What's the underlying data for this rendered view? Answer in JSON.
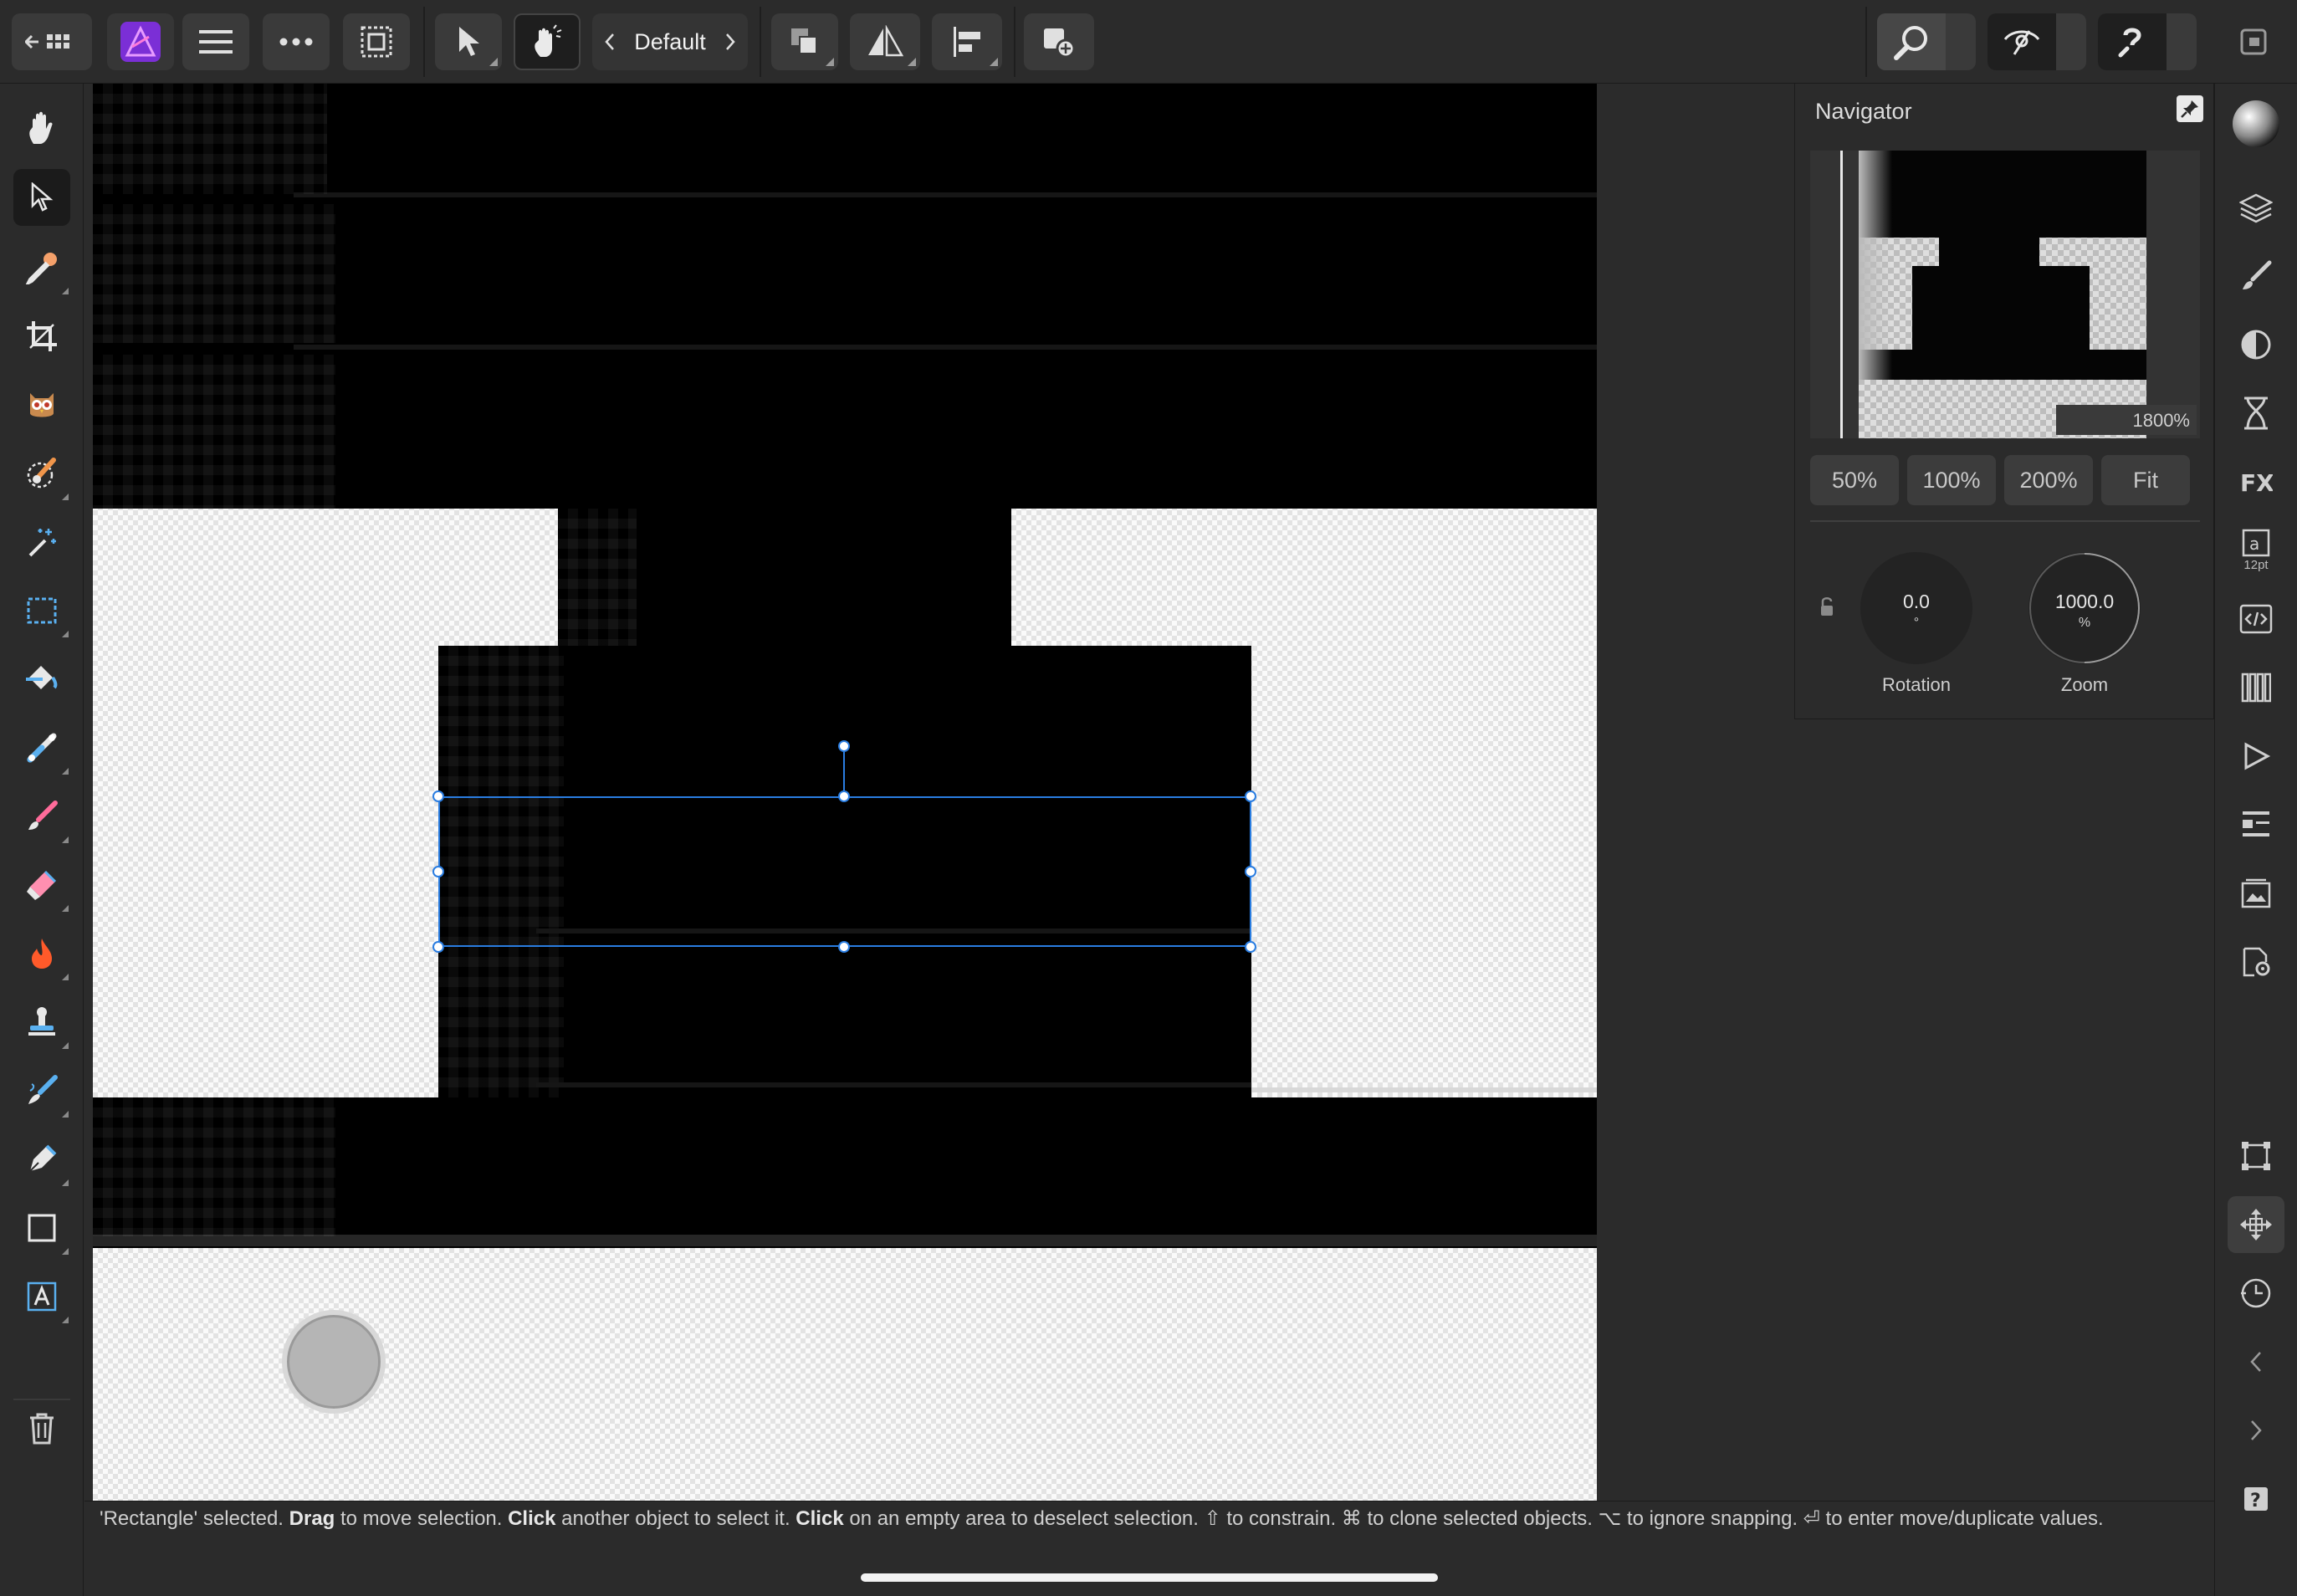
{
  "toolbar": {
    "persona": "Default",
    "buttons": [
      {
        "name": "back-apps-button",
        "icon": "back-grid-icon"
      },
      {
        "name": "app-logo",
        "icon": "affinity-photo-icon"
      },
      {
        "name": "menu-button",
        "icon": "hamburger-icon"
      },
      {
        "name": "more-button",
        "icon": "ellipsis-icon"
      },
      {
        "name": "selection-button",
        "icon": "marquee-icon"
      },
      {
        "name": "move-tool-button",
        "icon": "pointer-icon"
      },
      {
        "name": "touch-modifier-button",
        "icon": "hand-touch-icon"
      },
      {
        "name": "arrange-button",
        "icon": "arrange-icon"
      },
      {
        "name": "flip-button",
        "icon": "flip-icon"
      },
      {
        "name": "align-button",
        "icon": "align-left-icon"
      },
      {
        "name": "add-layer-button",
        "icon": "add-layer-icon"
      },
      {
        "name": "view-zoom-button",
        "icon": "magnifier-icon"
      },
      {
        "name": "view-mode-button",
        "icon": "eye-off-icon"
      },
      {
        "name": "assistant-button",
        "icon": "assistant-icon"
      },
      {
        "name": "window-button",
        "icon": "window-icon"
      }
    ]
  },
  "tools": [
    {
      "name": "view-tool",
      "icon": "hand-icon"
    },
    {
      "name": "move-tool",
      "icon": "pointer-icon",
      "active": true
    },
    {
      "name": "color-picker-tool",
      "icon": "eyedropper-icon"
    },
    {
      "name": "crop-tool",
      "icon": "crop-icon"
    },
    {
      "name": "red-eye-tool",
      "icon": "owl-icon"
    },
    {
      "name": "selection-brush-tool",
      "icon": "selection-brush-icon"
    },
    {
      "name": "flood-select-tool",
      "icon": "magic-wand-icon"
    },
    {
      "name": "marquee-tool",
      "icon": "marquee-icon"
    },
    {
      "name": "flood-fill-tool",
      "icon": "paint-bucket-icon"
    },
    {
      "name": "gradient-tool",
      "icon": "gradient-icon"
    },
    {
      "name": "paint-brush-tool",
      "icon": "paint-brush-icon"
    },
    {
      "name": "erase-brush-tool",
      "icon": "eraser-icon"
    },
    {
      "name": "burn-tool",
      "icon": "flame-icon"
    },
    {
      "name": "clone-tool",
      "icon": "stamp-icon"
    },
    {
      "name": "smudge-tool",
      "icon": "smudge-brush-icon"
    },
    {
      "name": "pen-tool",
      "icon": "pen-icon"
    },
    {
      "name": "rectangle-tool",
      "icon": "rectangle-icon"
    },
    {
      "name": "text-tool",
      "icon": "text-frame-icon"
    },
    {
      "name": "delete-button",
      "icon": "trash-icon"
    }
  ],
  "navigator": {
    "title": "Navigator",
    "preview_zoom": "1800%",
    "zoom_presets": [
      "50%",
      "100%",
      "200%",
      "Fit"
    ],
    "rotation": {
      "value": "0.0",
      "unit": "°",
      "label": "Rotation"
    },
    "zoom": {
      "value": "1000.0",
      "unit": "%",
      "label": "Zoom"
    }
  },
  "studio": [
    {
      "name": "color-studio",
      "icon": "color-sphere-icon"
    },
    {
      "name": "layers-studio",
      "icon": "layers-icon"
    },
    {
      "name": "brushes-studio",
      "icon": "brush-icon"
    },
    {
      "name": "adjustments-studio",
      "icon": "adjustment-icon"
    },
    {
      "name": "history-studio",
      "icon": "hourglass-icon"
    },
    {
      "name": "effects-studio",
      "icon": "fx-icon"
    },
    {
      "name": "character-studio",
      "icon": "text-size-icon",
      "label": "12pt"
    },
    {
      "name": "macro-studio",
      "icon": "code-icon"
    },
    {
      "name": "channels-studio",
      "icon": "channels-icon"
    },
    {
      "name": "play-studio",
      "icon": "play-icon"
    },
    {
      "name": "transform-studio",
      "icon": "list-icon"
    },
    {
      "name": "stock-studio",
      "icon": "photo-stack-icon"
    },
    {
      "name": "settings-studio",
      "icon": "gear-doc-icon"
    },
    {
      "name": "snapping-button",
      "icon": "snapping-icon"
    },
    {
      "name": "navigator-studio",
      "icon": "move-arrows-icon",
      "active": true
    },
    {
      "name": "history-clock-studio",
      "icon": "clock-icon"
    },
    {
      "name": "undo-button",
      "icon": "chevron-left-icon"
    },
    {
      "name": "redo-button",
      "icon": "chevron-right-icon"
    },
    {
      "name": "help-button",
      "icon": "help-icon"
    }
  ],
  "status": {
    "p1": "'Rectangle' selected. ",
    "b1": "Drag",
    "p2": " to move selection. ",
    "b2": "Click",
    "p3": " another object to select it. ",
    "b3": "Click",
    "p4": " on an empty area to deselect selection. ⇧ to constrain. ⌘ to clone selected objects. ⌥ to ignore snapping. ⏎ to enter move/duplicate values."
  },
  "colors": {
    "selection": "#2a7de1",
    "accent_logo": "#a64cf0"
  }
}
